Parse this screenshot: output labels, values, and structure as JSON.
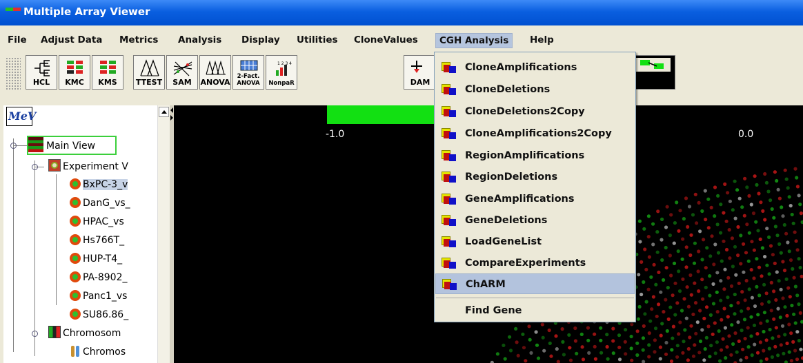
{
  "window": {
    "title": "Multiple Array Viewer"
  },
  "menubar": {
    "items": [
      "File",
      "Adjust Data",
      "Metrics",
      "Analysis",
      "Display",
      "Utilities",
      "CloneValues",
      "CGH Analysis",
      "Help"
    ],
    "active": "CGH Analysis"
  },
  "toolbar": {
    "buttons": [
      "HCL",
      "KMC",
      "KMS",
      "TTEST",
      "SAM",
      "ANOVA",
      "2-Fact. ANOVA",
      "NonpaR",
      "DAM"
    ]
  },
  "tree": {
    "logo": "MeV",
    "main_view": "Main View",
    "experiment": "Experiment V",
    "experiments": [
      "BxPC-3_v",
      "DanG_vs_",
      "HPAC_vs",
      "Hs766T_",
      "HUP-T4_",
      "PA-8902_",
      "Panc1_vs",
      "SU86.86_"
    ],
    "chromosome": "Chromosom",
    "chromosome_child": "Chromos"
  },
  "canvas": {
    "scale_min": "-1.0",
    "scale_max": "0.0"
  },
  "cgh_menu": {
    "items": [
      "CloneAmplifications",
      "CloneDeletions",
      "CloneDeletions2Copy",
      "CloneAmplifications2Copy",
      "RegionAmplifications",
      "RegionDeletions",
      "GeneAmplifications",
      "GeneDeletions",
      "LoadGeneList",
      "CompareExperiments",
      "ChARM"
    ],
    "highlighted": "ChARM",
    "find_gene": "Find Gene"
  },
  "colors": {
    "titlebar": "#0a5fe0",
    "highlight": "#b3c3dd",
    "scale_green": "#12e012"
  }
}
